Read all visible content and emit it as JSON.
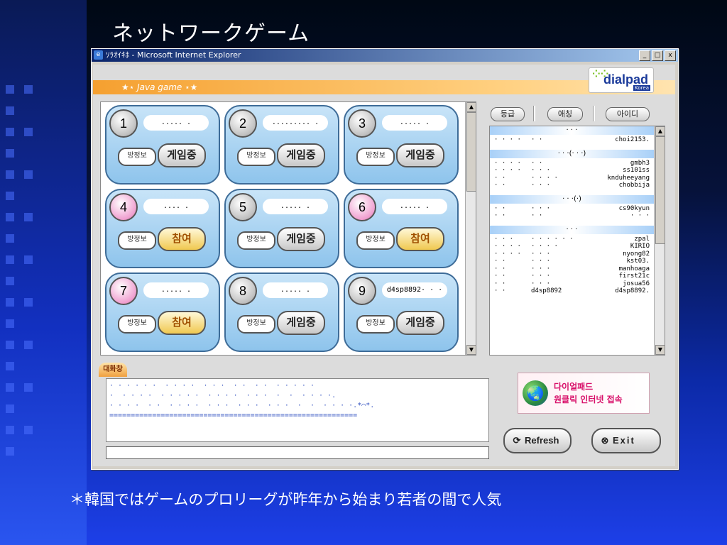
{
  "slide": {
    "title": "ネットワークゲーム",
    "caption": "＊韓国ではゲームのプロリーグが昨年から始まり若者の間で人気"
  },
  "window": {
    "title": "ｿﾗｵｲｷﾎ - Microsoft Internet Explorer",
    "btn_min": "_",
    "btn_max": "□",
    "btn_close": "x"
  },
  "header": {
    "java_label": "★⋆ Java game ⋆★",
    "logo_text": "dialpad",
    "logo_sub": "Korea"
  },
  "rooms": [
    {
      "num": "1",
      "name": "..... .",
      "info": "방정보",
      "action": "게임중"
    },
    {
      "num": "2",
      "name": "......... .",
      "info": "방정보",
      "action": "게임중"
    },
    {
      "num": "3",
      "name": "..... .",
      "info": "방정보",
      "action": "게임중"
    },
    {
      "num": "4",
      "name": ".... .",
      "info": "방정보",
      "action": "참여"
    },
    {
      "num": "5",
      "name": "..... .",
      "info": "방정보",
      "action": "게임중"
    },
    {
      "num": "6",
      "name": "..... .",
      "info": "방정보",
      "action": "참여"
    },
    {
      "num": "7",
      "name": "..... .",
      "info": "방정보",
      "action": "참여"
    },
    {
      "num": "8",
      "name": "..... .",
      "info": "방정보",
      "action": "게임중"
    },
    {
      "num": "9",
      "name": "d4sp8892· · ·",
      "info": "방정보",
      "action": "게임중"
    }
  ],
  "user_tabs": [
    "등급",
    "애칭",
    "아이디"
  ],
  "user_groups": [
    {
      "head": "· · ·",
      "rows": [
        [
          "· · · ·",
          "· ·",
          "choi2153."
        ]
      ]
    },
    {
      "head": "· · ·(· · ·)",
      "rows": [
        [
          "· · · ·",
          "· ·",
          "gmbh3"
        ],
        [
          "· · · ·",
          "· · ·",
          "ss101ss"
        ],
        [
          "· ·",
          "· · · ·",
          "knduheeyang"
        ],
        [
          "· ·",
          "· · ·",
          "chobbija"
        ]
      ]
    },
    {
      "head": "· · ·(·)",
      "rows": [
        [
          "· ·",
          "· · ·",
          "cs90kyun"
        ],
        [
          "· ·",
          "· ·",
          "· · ·"
        ]
      ]
    },
    {
      "head": "· · ·",
      "rows": [
        [
          "· · ·",
          "· · · · · ·",
          "zpal"
        ],
        [
          "· · · ·",
          "· · · ·",
          "KIRIO"
        ],
        [
          "· · · ·",
          "· · ·",
          "nyong82"
        ],
        [
          "· ·",
          "· · ·",
          "kst03."
        ],
        [
          "· ·",
          "· · ·",
          "manhoaga"
        ],
        [
          "· ·",
          "· · ·",
          "first21c"
        ],
        [
          "· ·",
          "· · ·",
          "josua56"
        ],
        [
          "· ·",
          "d4sp8892",
          "d4sp8892."
        ]
      ]
    }
  ],
  "chat": {
    "tab": "대화창",
    "lines": [
      "· · · · · ·  · · · ·  · · ·  · ·  · ·  · · · · ·",
      "·  · · · ·  · · · · ·  · · · ·  · · ·  ·  ·  · · · ·.",
      "· · · ·  · ·  · · · ·  · · ·  · · ·  · · ·  ·  ·  · · · ·.*⌒*.",
      "=========================================================="
    ]
  },
  "ad": {
    "line1": "다이얼패드",
    "line2": "원클릭 인터넷 접속"
  },
  "buttons": {
    "refresh": "Refresh",
    "exit": "Exit"
  }
}
